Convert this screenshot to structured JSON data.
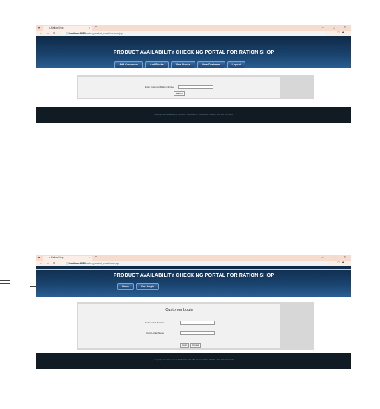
{
  "browser": {
    "tab_title": "d-RationShop",
    "new_tab_glyph": "+",
    "tab_close_glyph": "×",
    "window_controls": "– ▢ ×",
    "nav_back": "←",
    "nav_forward": "→",
    "nav_reload": "C",
    "nav_info": "ⓘ",
    "star_glyph": "☆",
    "menu_glyph": "⋮",
    "profile_glyph": "●"
  },
  "portal_title": "PRODUCT AVAILABILITY CHECKING PORTAL FOR RATION SHOP",
  "footer_text": "Copyright Joint Reserved @ PRODUCT AVAILABILITY CHECKING PORTAL FOR RATION SHOP",
  "screen1": {
    "url_host": "localhost:8080",
    "url_path": "/ration_product_check/viewrcw.jsp",
    "menu": [
      "Add Customers",
      "Add Stocks",
      "View Stocks",
      "View Customer",
      "Logout"
    ],
    "ration_label": "Enter Customer Ration Number",
    "ration_value": "",
    "search_button": "Search"
  },
  "screen2": {
    "url_host": "localhost:8080",
    "url_path": "/ration_product_check/user.jsp",
    "menu": [
      "Home",
      "User Login"
    ],
    "login_heading": "Customer Login",
    "ration_card_label": "Ration Card Number",
    "ration_card_value": "",
    "card_holder_label": "Card Holder Name",
    "card_holder_value": "",
    "login_button": "Login",
    "cancel_button": "Cancel"
  },
  "colors": {
    "header_dark": "#0f2a47",
    "header_light": "#2a5e92",
    "footer": "#111b24",
    "tabbar": "#f6dccf",
    "panel": "#d7d7d7"
  }
}
